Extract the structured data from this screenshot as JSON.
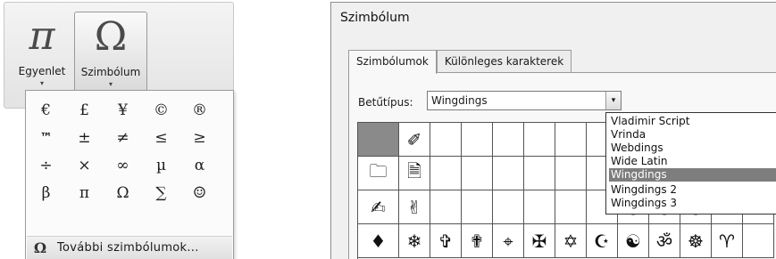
{
  "ribbon": {
    "equation": {
      "icon": "pi",
      "glyph": "π",
      "label": "Egyenlet"
    },
    "symbol": {
      "icon": "omega",
      "glyph": "Ω",
      "label": "Szimbólum"
    },
    "dropdown_arrow": "▾"
  },
  "gallery": {
    "symbols": [
      "€",
      "£",
      "¥",
      "©",
      "®",
      "™",
      "±",
      "≠",
      "≤",
      "≥",
      "÷",
      "×",
      "∞",
      "µ",
      "α",
      "β",
      "π",
      "Ω",
      "∑",
      "☺"
    ],
    "more": {
      "glyph": "Ω",
      "label": "További szimbólumok..."
    }
  },
  "dialog": {
    "title": "Szimbólum",
    "tabs": [
      {
        "label": "Szimbólumok",
        "active": true
      },
      {
        "label": "Különleges karakterek",
        "active": false
      }
    ],
    "font_label": "Betűtípus:",
    "font_value": "Wingdings",
    "font_dropdown_icon": "▾",
    "font_list": [
      "Vladimir Script",
      "Vrinda",
      "Webdings",
      "Wide Latin",
      "Wingdings",
      "Wingdings 2",
      "Wingdings 3"
    ],
    "font_list_selected": "Wingdings",
    "scroll_up": "▲",
    "scroll_down": "▼",
    "symbol_rows": [
      [
        "",
        "✐",
        "",
        "",
        "",
        "",
        "",
        "",
        "☎",
        "✆",
        "✉",
        "✎",
        ""
      ],
      [
        "🗀",
        "🗎",
        "",
        "",
        "",
        "",
        "",
        "",
        "✇",
        "🖳",
        "▭",
        "🖫",
        ""
      ],
      [
        "✍",
        "✌",
        "",
        "",
        "",
        "",
        "",
        "",
        "☺",
        "☹",
        "☹",
        "☠",
        ""
      ],
      [
        "♦",
        "❄",
        "✞",
        "✟",
        "⌖",
        "✠",
        "✡",
        "☪",
        "☯",
        "ॐ",
        "☸",
        "♈",
        ""
      ]
    ]
  },
  "colors": {
    "selected_cell": "#8a8a8a",
    "highlight": "#7d7d7d",
    "dialog_bg": "#f0f0f0"
  }
}
